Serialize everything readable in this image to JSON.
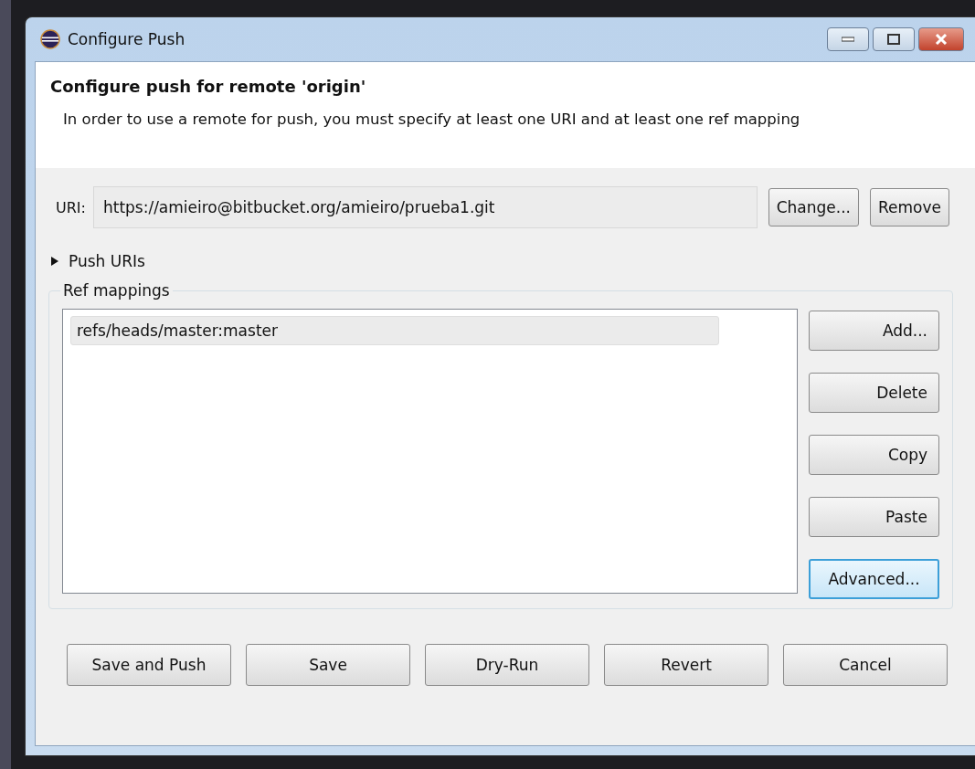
{
  "window": {
    "title": "Configure Push"
  },
  "header": {
    "title": "Configure push for remote 'origin'",
    "description": "In order to use a remote for push, you must specify at least one URI and at least one ref mapping"
  },
  "uri": {
    "label": "URI:",
    "value": "https://amieiro@bitbucket.org/amieiro/prueba1.git",
    "buttons": [
      "Change...",
      "Remove"
    ]
  },
  "push_uris": {
    "label": "Push URIs",
    "expanded": false
  },
  "ref_mappings": {
    "label": "Ref mappings",
    "items": [
      {
        "text": "refs/heads/master:master",
        "selected": true
      }
    ],
    "buttons": [
      {
        "label": "Add...",
        "focused": false
      },
      {
        "label": "Delete",
        "focused": false
      },
      {
        "label": "Copy",
        "focused": false
      },
      {
        "label": "Paste",
        "focused": false
      },
      {
        "label": "Advanced...",
        "focused": true
      }
    ]
  },
  "buttons": [
    "Save and Push",
    "Save",
    "Dry-Run",
    "Revert",
    "Cancel"
  ]
}
